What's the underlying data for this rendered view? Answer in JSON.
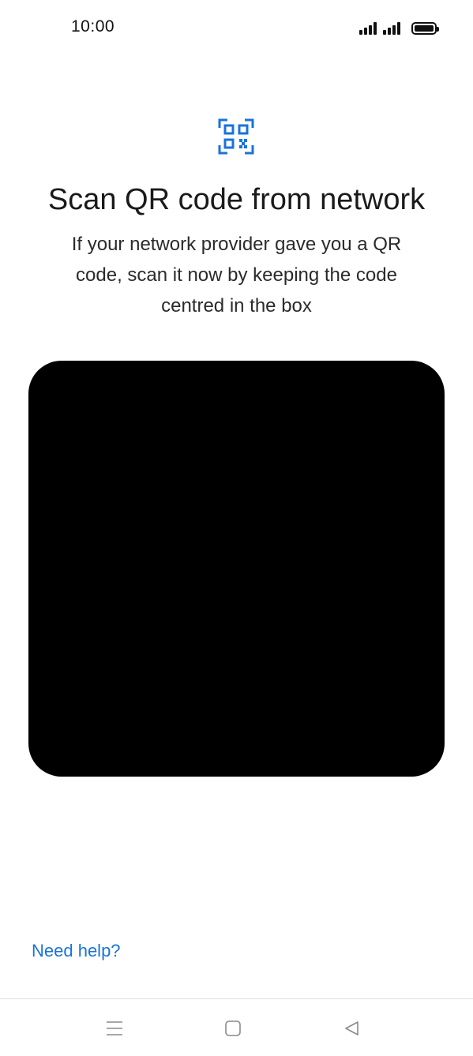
{
  "status_bar": {
    "time": "10:00",
    "icons": [
      "signal-icon",
      "signal-icon",
      "battery-icon"
    ]
  },
  "header": {
    "icon": "qr-code-scan-icon",
    "title": "Scan QR code from network",
    "subtitle": "If your network provider gave you a QR code, scan it now by keeping the code centred in the box"
  },
  "footer": {
    "help_label": "Need help?"
  },
  "nav_bar": {
    "icons": [
      "menu-icon",
      "home-icon",
      "back-icon"
    ]
  },
  "colors": {
    "accent": "#1a73d9",
    "viewfinder": "#000000",
    "text": "#1a1a1a"
  }
}
